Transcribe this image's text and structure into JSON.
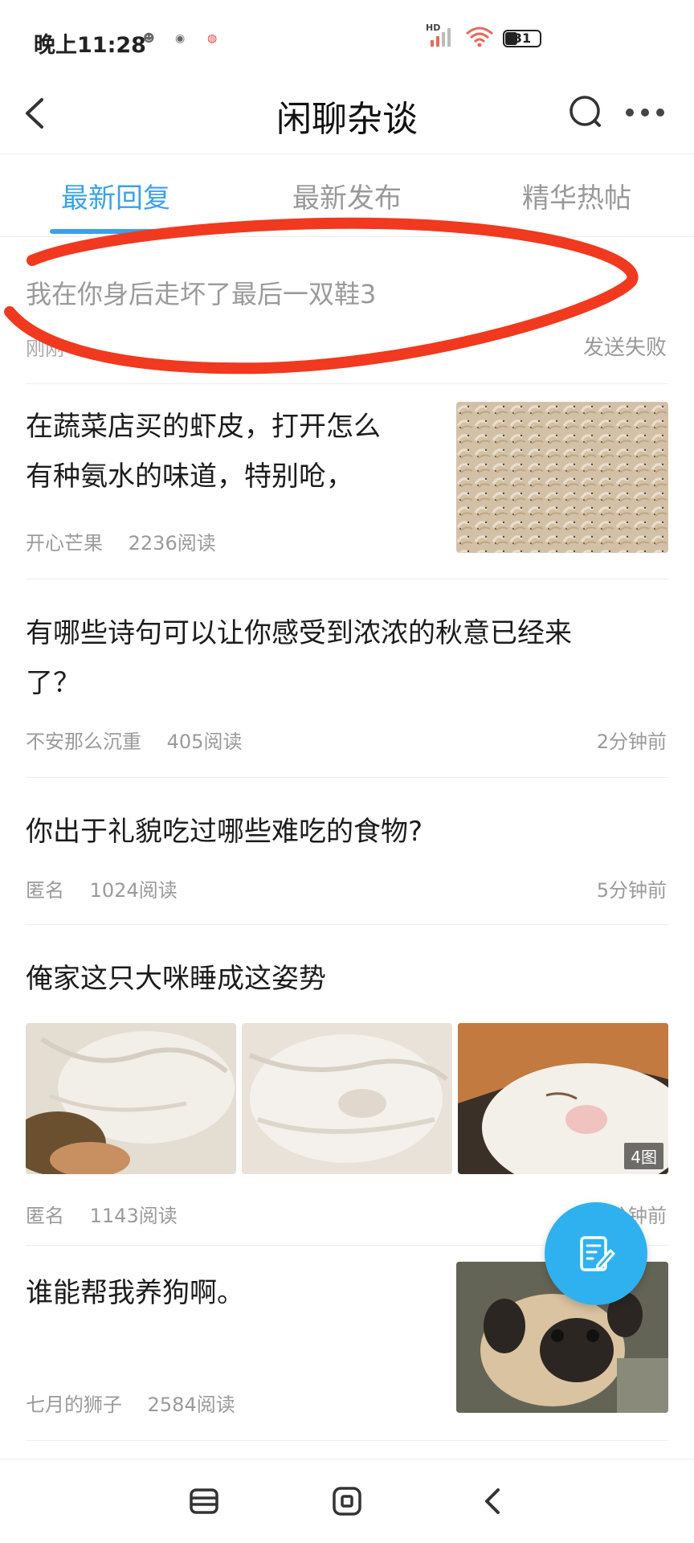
{
  "status_bar": {
    "time": "晚上11:28",
    "network_label": "HD",
    "battery_level": "31"
  },
  "header": {
    "title": "闲聊杂谈",
    "back_icon": "chevron-left-icon",
    "search_icon": "search-icon",
    "more_icon": "more-dots-icon"
  },
  "tabs": [
    {
      "label": "最新回复",
      "active": true
    },
    {
      "label": "最新发布",
      "active": false
    },
    {
      "label": "精华热帖",
      "active": false
    }
  ],
  "draft": {
    "title": "我在你身后走坏了最后一双鞋3",
    "meta_left": "刚刚",
    "status": "发送失败"
  },
  "posts": [
    {
      "title_line1": "在蔬菜店买的虾皮，打开怎么",
      "title_line2": "有种氨水的味道，特别呛，",
      "author": "开心芒果",
      "reads": "2236阅读",
      "time": ""
    },
    {
      "title_line1": "有哪些诗句可以让你感受到浓浓的秋意已经来",
      "title_line2": "了？",
      "author": "不安那么沉重",
      "reads": "405阅读",
      "time": "2分钟前"
    },
    {
      "title_line1": "你出于礼貌吃过哪些难吃的食物?",
      "author": "匿名",
      "reads": "1024阅读",
      "time": "5分钟前"
    },
    {
      "title_line1": "俺家这只大咪睡成这姿势",
      "author": "匿名",
      "reads": "1143阅读",
      "time": "6分钟前",
      "image_count": "4图"
    },
    {
      "title_line1": "谁能帮我养狗啊。",
      "author": "七月的狮子",
      "reads": "2584阅读",
      "time": ""
    }
  ],
  "fab": {
    "icon": "edit-post-icon"
  },
  "colors": {
    "accent": "#3aa2e8",
    "fab": "#2fb1ef",
    "annotation_red": "#f0391f"
  }
}
